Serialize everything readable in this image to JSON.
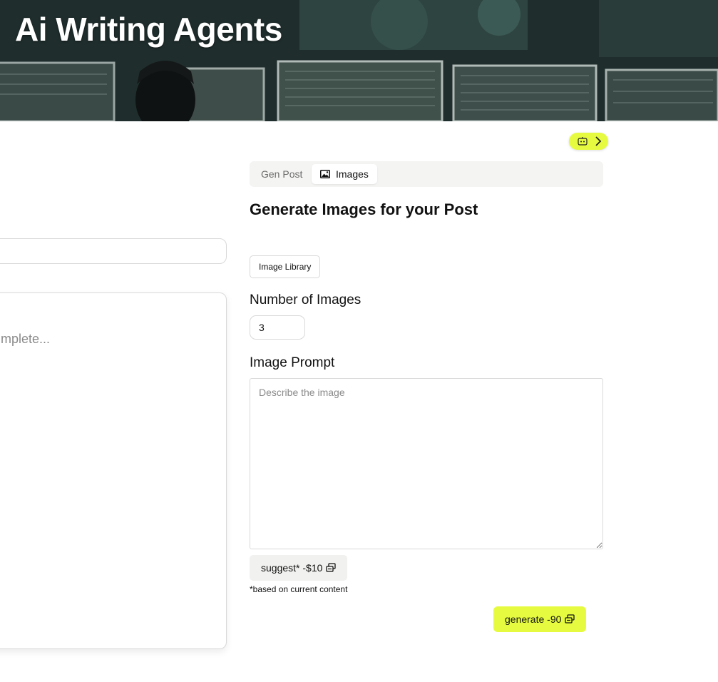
{
  "hero": {
    "title": "Ai Writing Agents"
  },
  "left_panel": {
    "editor_placeholder": "mplete..."
  },
  "tabs": [
    {
      "label": "Gen Post",
      "active": false
    },
    {
      "label": "Images",
      "icon": "image-icon",
      "active": true
    }
  ],
  "section": {
    "title": "Generate Images for your Post"
  },
  "image_library_button": "Image Library",
  "number_of_images": {
    "label": "Number of Images",
    "value": "3"
  },
  "image_prompt": {
    "label": "Image Prompt",
    "placeholder": "Describe the image"
  },
  "suggest_button": {
    "label": "suggest* -$10",
    "icon": "coins-icon"
  },
  "note": "*based on current content",
  "generate_button": {
    "label": "generate -90",
    "icon": "coins-icon"
  },
  "colors": {
    "accent": "#e6fb3f",
    "tab_bg": "#f4f4f2",
    "border": "#d9d9d9"
  },
  "icons": {
    "toggle": [
      "robot-icon",
      "chevron-right-icon"
    ]
  }
}
